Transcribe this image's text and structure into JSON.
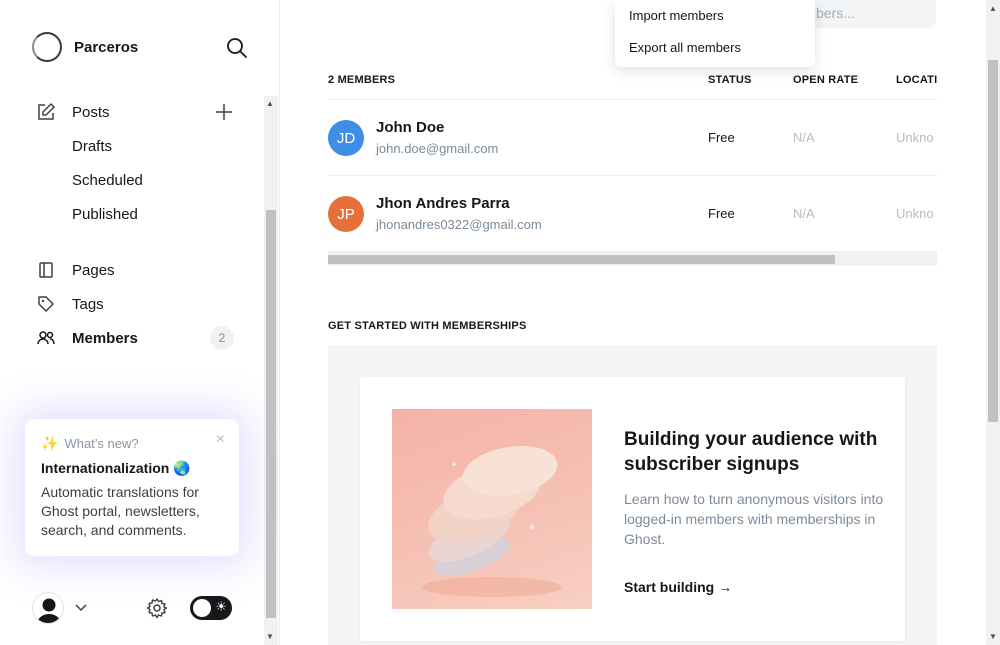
{
  "sidebar": {
    "brand": "Parceros",
    "nav": {
      "posts": "Posts",
      "drafts": "Drafts",
      "scheduled": "Scheduled",
      "published": "Published",
      "pages": "Pages",
      "tags": "Tags",
      "members": "Members",
      "members_count": "2"
    },
    "whats_new": {
      "header": "What’s new?",
      "title": "Internationalization 🌏",
      "body": "Automatic translations for Ghost portal, newsletters, search, and comments."
    }
  },
  "search": {
    "placeholder_partial": "bers..."
  },
  "actions_menu": {
    "import": "Import members",
    "export": "Export all members"
  },
  "table": {
    "count_label": "2 MEMBERS",
    "columns": {
      "status": "STATUS",
      "open_rate": "OPEN RATE",
      "location": "LOCATI"
    },
    "rows": [
      {
        "initials": "JD",
        "name": "John Doe",
        "email": "john.doe@gmail.com",
        "status": "Free",
        "open_rate": "N/A",
        "location": "Unkno",
        "color": "#3e8ee6"
      },
      {
        "initials": "JP",
        "name": "Jhon Andres Parra",
        "email": "jhonandres0322@gmail.com",
        "status": "Free",
        "open_rate": "N/A",
        "location": "Unkno",
        "color": "#e5703a"
      }
    ]
  },
  "get_started": {
    "section_title": "GET STARTED WITH MEMBERSHIPS",
    "heading": "Building your audience with subscriber signups",
    "description": "Learn how to turn anonymous visitors into logged-in members with memberships in Ghost.",
    "link": "Start building →"
  }
}
